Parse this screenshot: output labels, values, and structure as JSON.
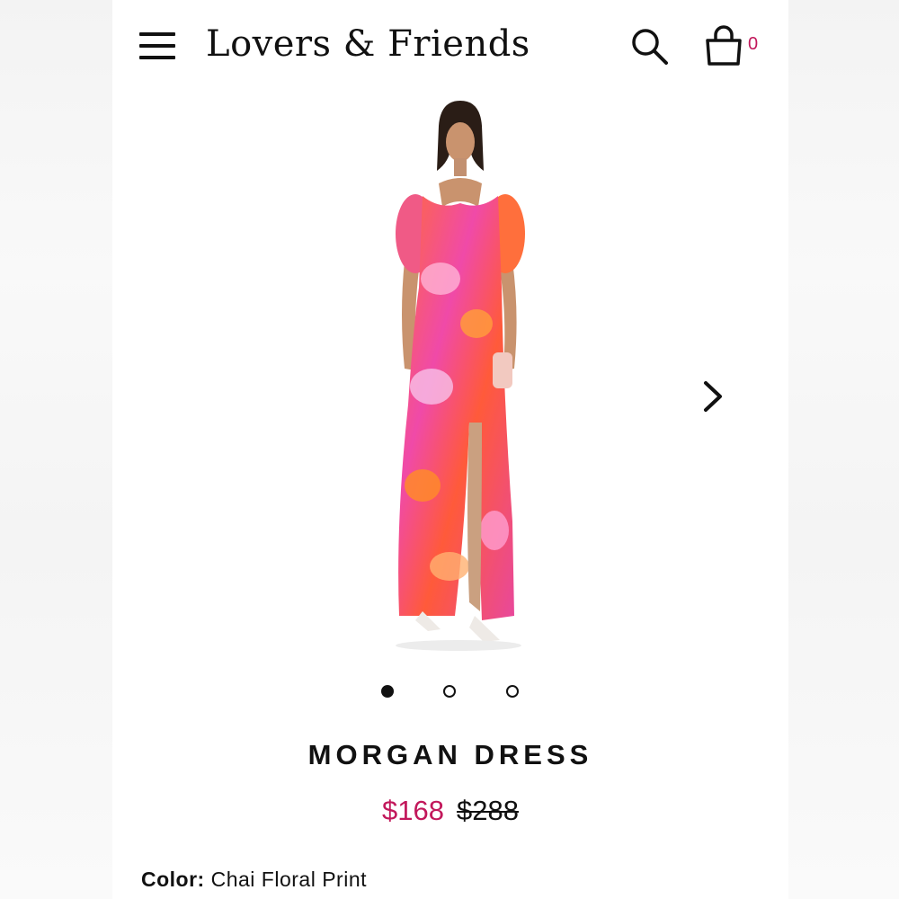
{
  "header": {
    "brand": "Lovers & Friends",
    "cart_count": "0",
    "menu_icon": "hamburger-menu-icon",
    "search_icon": "search-icon",
    "bag_icon": "shopping-bag-icon"
  },
  "gallery": {
    "image": "product photo of model wearing floral maxi dress",
    "next_icon": "chevron-right-icon",
    "page_count": 3,
    "active_page": 1
  },
  "product": {
    "name": "MORGAN DRESS",
    "sale_price": "$168",
    "original_price": "$288",
    "color_label": "Color:",
    "color_value": "Chai Floral Print"
  },
  "colors": {
    "accent": "#c2185b",
    "text": "#111111",
    "background": "#ffffff"
  }
}
